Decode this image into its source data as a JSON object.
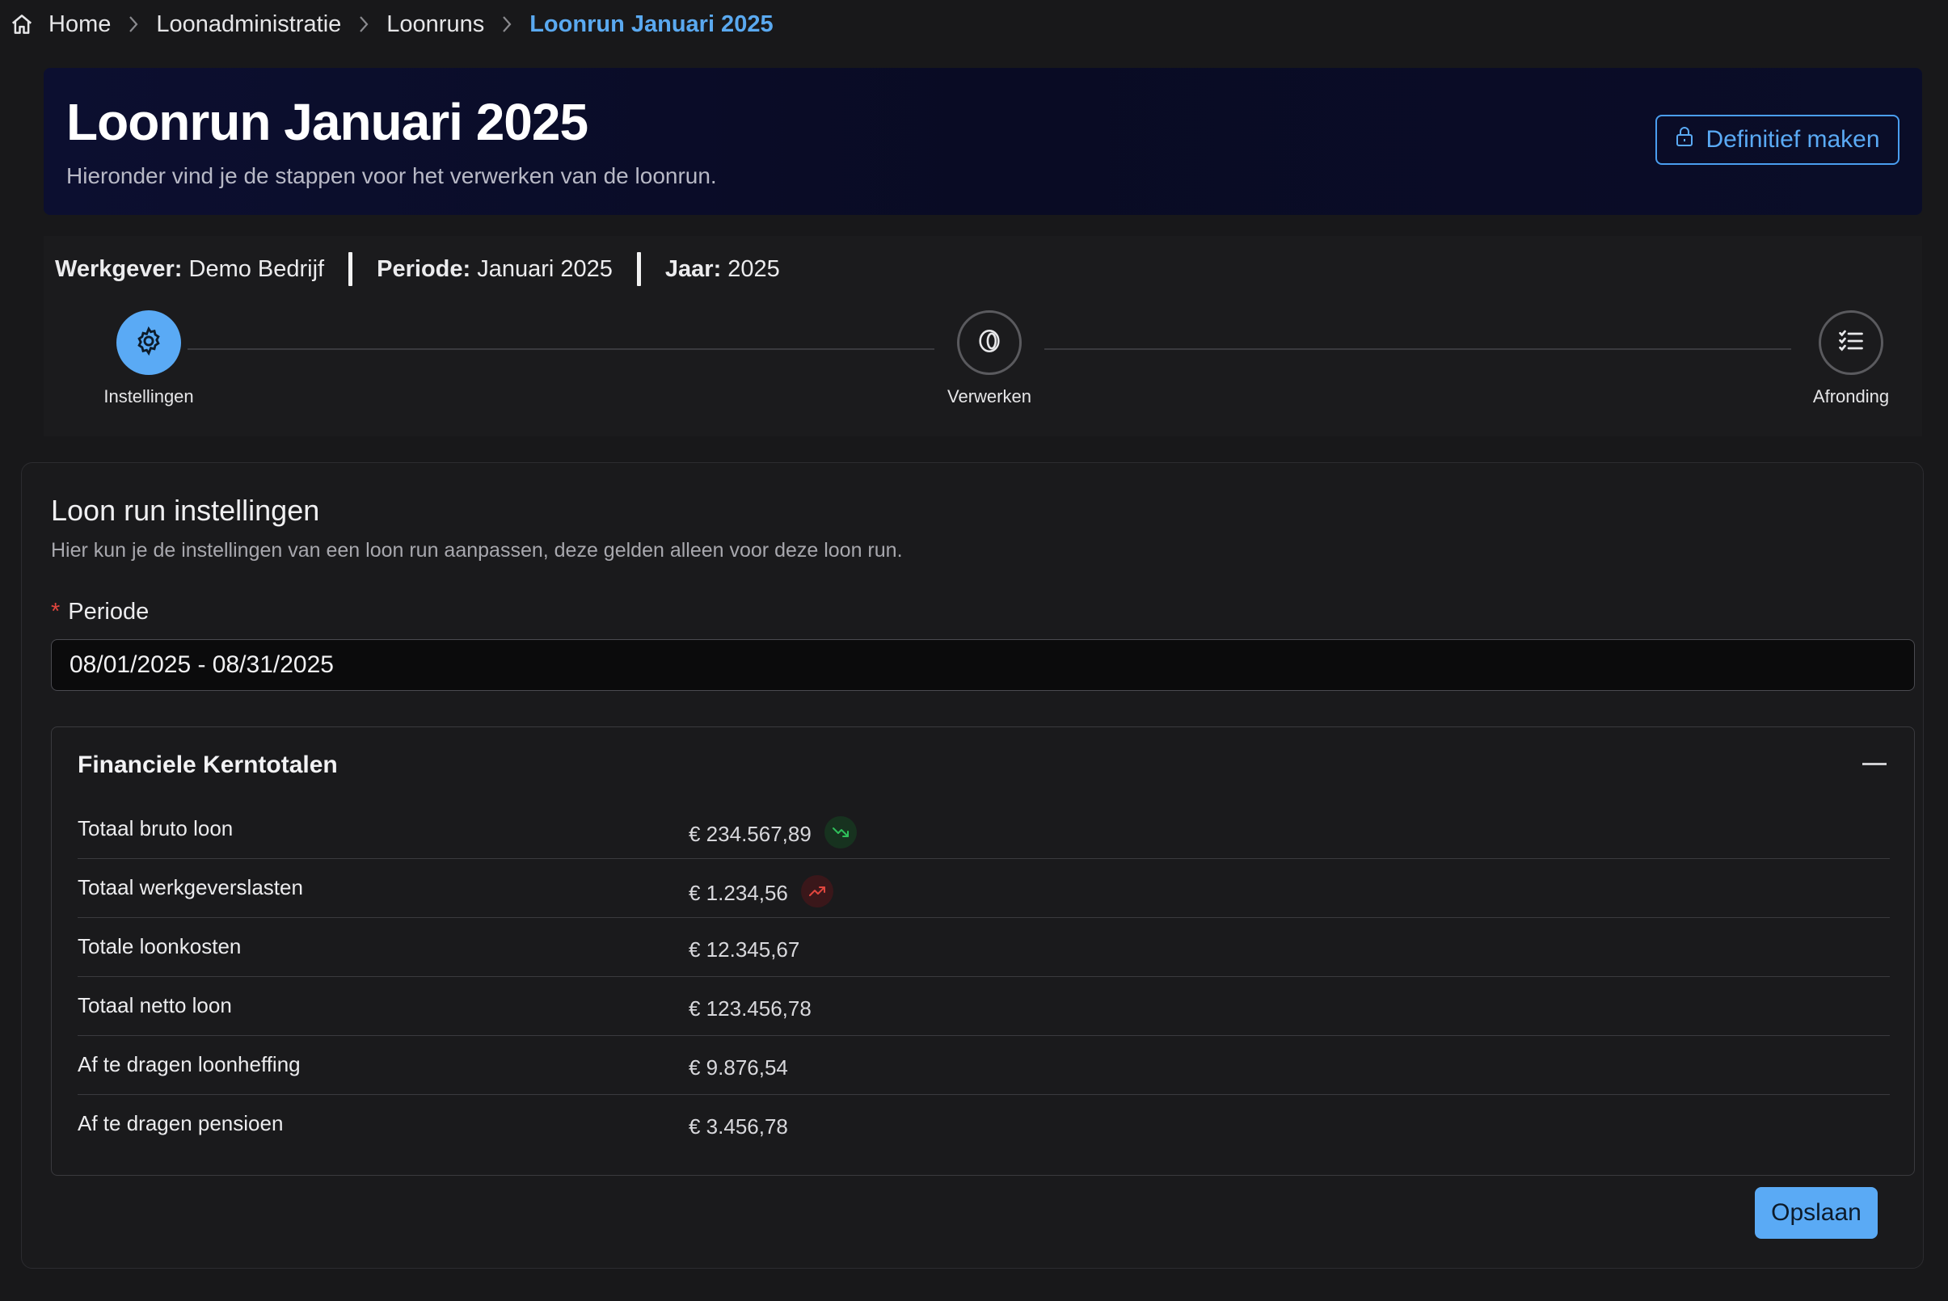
{
  "breadcrumb": {
    "items": [
      {
        "label": "Home",
        "icon": "home-icon"
      },
      {
        "label": "Loonadministratie"
      },
      {
        "label": "Loonruns"
      },
      {
        "label": "Loonrun Januari 2025",
        "current": true
      }
    ]
  },
  "hero": {
    "title": "Loonrun Januari 2025",
    "subtitle": "Hieronder vind je de stappen voor het verwerken van de loonrun.",
    "action_label": "Definitief maken",
    "action_icon": "lock-icon"
  },
  "meta": {
    "employer_label": "Werkgever:",
    "employer_value": "Demo Bedrijf",
    "period_label": "Periode:",
    "period_value": "Januari 2025",
    "year_label": "Jaar:",
    "year_value": "2025"
  },
  "steps": [
    {
      "label": "Instellingen",
      "icon": "gear-icon",
      "active": true
    },
    {
      "label": "Verwerken",
      "icon": "coin-icon",
      "active": false
    },
    {
      "label": "Afronding",
      "icon": "checklist-icon",
      "active": false
    }
  ],
  "settings": {
    "title": "Loon run instellingen",
    "description": "Hier kun je de instellingen van een loon run aanpassen, deze gelden alleen voor deze loon run.",
    "period_field_label": "Periode",
    "period_field_value": "08/01/2025 - 08/31/2025"
  },
  "totals": {
    "title": "Financiele Kerntotalen",
    "rows": [
      {
        "label": "Totaal bruto loon",
        "value": "€ 234.567,89",
        "trend": "down"
      },
      {
        "label": "Totaal werkgeverslasten",
        "value": "€ 1.234,56",
        "trend": "up"
      },
      {
        "label": "Totale loonkosten",
        "value": "€ 12.345,67",
        "trend": null
      },
      {
        "label": "Totaal netto loon",
        "value": "€ 123.456,78",
        "trend": null
      },
      {
        "label": "Af te dragen loonheffing",
        "value": "€ 9.876,54",
        "trend": null
      },
      {
        "label": "Af te dragen pensioen",
        "value": "€ 3.456,78",
        "trend": null
      }
    ]
  },
  "save_label": "Opslaan",
  "colors": {
    "accent": "#5aaaf5",
    "trend_down": "#2fbf5a",
    "trend_up": "#e0463e"
  }
}
